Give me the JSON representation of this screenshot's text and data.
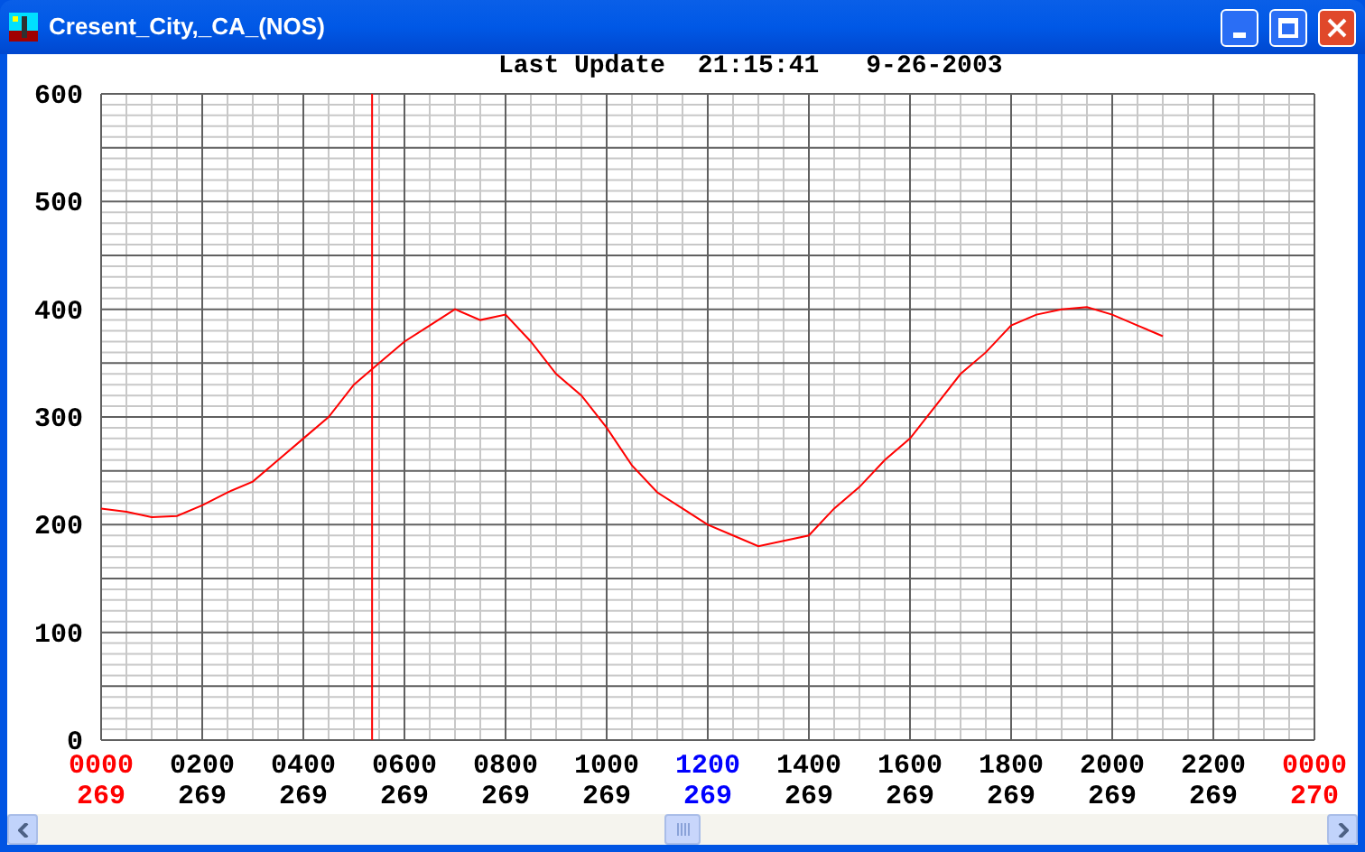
{
  "window": {
    "title": "Cresent_City,_CA_(NOS)"
  },
  "header": {
    "label": "Last Update",
    "time": "21:15:41",
    "date": "9-26-2003"
  },
  "plot": {
    "chart_data": {
      "type": "line",
      "grid": true,
      "xlim": [
        0,
        2400
      ],
      "ylim": [
        0,
        600
      ],
      "yticks": [
        0,
        100,
        200,
        300,
        400,
        500,
        600
      ],
      "xticks": [
        {
          "value": 0,
          "label": "0000"
        },
        {
          "value": 200,
          "label": "0200"
        },
        {
          "value": 400,
          "label": "0400"
        },
        {
          "value": 600,
          "label": "0600"
        },
        {
          "value": 800,
          "label": "0800"
        },
        {
          "value": 1000,
          "label": "1000"
        },
        {
          "value": 1200,
          "label": "1200"
        },
        {
          "value": 1400,
          "label": "1400"
        },
        {
          "value": 1600,
          "label": "1600"
        },
        {
          "value": 1800,
          "label": "1800"
        },
        {
          "value": 2000,
          "label": "2000"
        },
        {
          "value": 2200,
          "label": "2200"
        }
      ],
      "x": [
        0,
        50,
        100,
        150,
        200,
        250,
        300,
        350,
        400,
        450,
        500,
        550,
        600,
        650,
        700,
        750,
        800,
        850,
        900,
        950,
        1000,
        1050,
        1100,
        1150,
        1200,
        1250,
        1300,
        1350,
        1400,
        1450,
        1500,
        1550,
        1600,
        1650,
        1700,
        1750,
        1800,
        1850,
        1900,
        1950,
        2000,
        2050,
        2100
      ],
      "series": [
        {
          "color": "#ff0000",
          "values": [
            215,
            212,
            207,
            208,
            218,
            230,
            240,
            260,
            280,
            300,
            330,
            350,
            370,
            385,
            400,
            390,
            395,
            370,
            340,
            320,
            290,
            255,
            230,
            215,
            200,
            190,
            180,
            185,
            190,
            215,
            235,
            260,
            280,
            310,
            340,
            360,
            385,
            395,
            400,
            402,
            395,
            385,
            375
          ]
        }
      ],
      "ref_lines": [
        {
          "axis": "x",
          "value": 536
        }
      ]
    },
    "next_day_tick": {
      "label": "0000"
    },
    "tick_days": [
      {
        "day": "269",
        "color": "#ff0000"
      },
      {
        "day": "269",
        "color": "#000000"
      },
      {
        "day": "269",
        "color": "#000000"
      },
      {
        "day": "269",
        "color": "#000000"
      },
      {
        "day": "269",
        "color": "#000000"
      },
      {
        "day": "269",
        "color": "#000000"
      },
      {
        "day": "269",
        "color": "#0000ff"
      },
      {
        "day": "269",
        "color": "#000000"
      },
      {
        "day": "269",
        "color": "#000000"
      },
      {
        "day": "269",
        "color": "#000000"
      },
      {
        "day": "269",
        "color": "#000000"
      },
      {
        "day": "269",
        "color": "#000000"
      },
      {
        "day": "270",
        "color": "#ff0000"
      }
    ]
  }
}
